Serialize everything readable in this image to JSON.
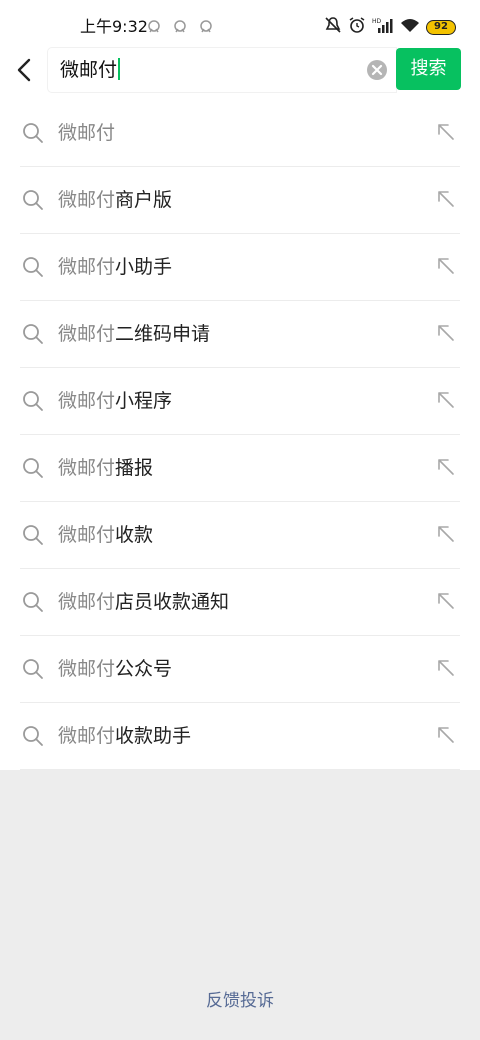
{
  "status_bar": {
    "time": "上午9:32",
    "battery": "92",
    "network_label": "HD"
  },
  "search": {
    "query": "微邮付",
    "button_label": "搜索"
  },
  "suggestions": [
    {
      "prefix": "微邮付",
      "suffix": ""
    },
    {
      "prefix": "微邮付",
      "suffix": "商户版"
    },
    {
      "prefix": "微邮付",
      "suffix": "小助手"
    },
    {
      "prefix": "微邮付",
      "suffix": "二维码申请"
    },
    {
      "prefix": "微邮付",
      "suffix": "小程序"
    },
    {
      "prefix": "微邮付",
      "suffix": "播报"
    },
    {
      "prefix": "微邮付",
      "suffix": "收款"
    },
    {
      "prefix": "微邮付",
      "suffix": "店员收款通知"
    },
    {
      "prefix": "微邮付",
      "suffix": "公众号"
    },
    {
      "prefix": "微邮付",
      "suffix": "收款助手"
    }
  ],
  "footer": {
    "feedback_label": "反馈投诉"
  },
  "colors": {
    "accent": "#07c160",
    "link": "#576b95",
    "background": "#ededed"
  }
}
